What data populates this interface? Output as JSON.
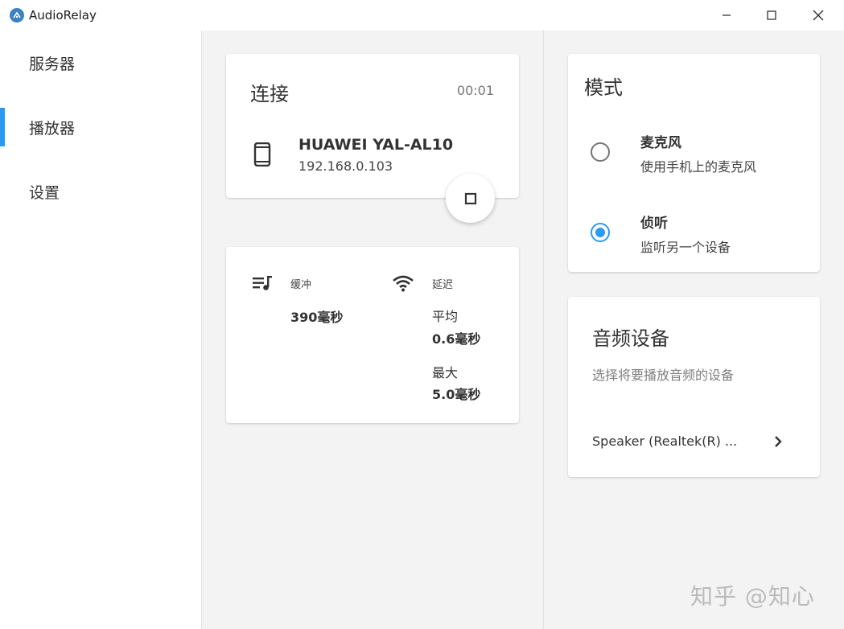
{
  "window": {
    "title": "AudioRelay"
  },
  "sidebar": {
    "items": [
      {
        "label": "服务器",
        "active": false
      },
      {
        "label": "播放器",
        "active": true
      },
      {
        "label": "设置",
        "active": false
      }
    ]
  },
  "connection": {
    "title": "连接",
    "timer": "00:01",
    "device_name": "HUAWEI YAL-AL10",
    "device_ip": "192.168.0.103",
    "icon": "smartphone-icon",
    "stop_icon": "stop-icon"
  },
  "stats": {
    "buffer_label": "缓冲",
    "buffer_value": "390毫秒",
    "latency_label": "延迟",
    "avg_label": "平均",
    "avg_value": "0.6毫秒",
    "max_label": "最大",
    "max_value": "5.0毫秒"
  },
  "mode": {
    "title": "模式",
    "options": [
      {
        "title": "麦克风",
        "desc": "使用手机上的麦克风",
        "selected": false
      },
      {
        "title": "侦听",
        "desc": "监听另一个设备",
        "selected": true
      }
    ]
  },
  "audio_device": {
    "title": "音频设备",
    "desc": "选择将要播放音频的设备",
    "selected": "Speaker (Realtek(R) ..."
  },
  "watermark": "知乎 @知心",
  "colors": {
    "accent": "#2b9af3",
    "background": "#f3f3f3",
    "card": "#ffffff"
  }
}
